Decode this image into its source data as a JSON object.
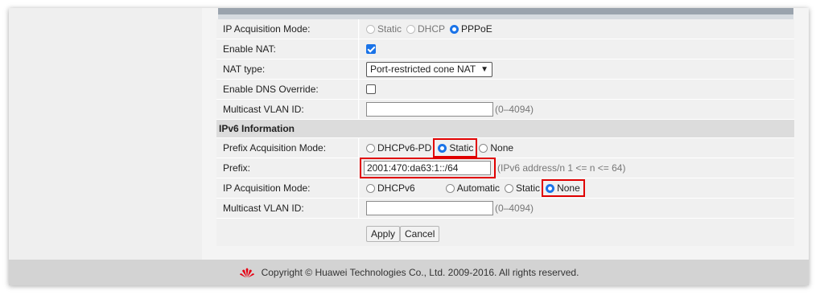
{
  "wan_ipv4": {
    "ip_acquisition": {
      "label": "IP Acquisition Mode:",
      "options": [
        "Static",
        "DHCP",
        "PPPoE"
      ],
      "selected": "PPPoE"
    },
    "enable_nat": {
      "label": "Enable NAT:",
      "checked": true
    },
    "nat_type": {
      "label": "NAT type:",
      "value": "Port-restricted cone NAT"
    },
    "dns_override": {
      "label": "Enable DNS Override:",
      "checked": false
    },
    "multicast_vlan": {
      "label": "Multicast VLAN ID:",
      "value": "",
      "hint": "(0–4094)"
    }
  },
  "ipv6": {
    "section_title": "IPv6 Information",
    "prefix_mode": {
      "label": "Prefix Acquisition Mode:",
      "options": [
        "DHCPv6-PD",
        "Static",
        "None"
      ],
      "selected": "Static"
    },
    "prefix": {
      "label": "Prefix:",
      "value": "2001:470:da63:1::/64",
      "hint": "(IPv6 address/n 1 <= n <= 64)"
    },
    "ip_acquisition": {
      "label": "IP Acquisition Mode:",
      "options": [
        "DHCPv6",
        "Automatic",
        "Static",
        "None"
      ],
      "selected": "None"
    },
    "multicast_vlan": {
      "label": "Multicast VLAN ID:",
      "value": "",
      "hint": "(0–4094)"
    }
  },
  "buttons": {
    "apply": "Apply",
    "cancel": "Cancel"
  },
  "footer": {
    "text": "Copyright © Huawei Technologies Co., Ltd. 2009-2016. All rights reserved.",
    "logo_icon": "huawei-logo-icon"
  },
  "colors": {
    "highlight": "#e00000",
    "radio_selected": "#1a73e8"
  }
}
